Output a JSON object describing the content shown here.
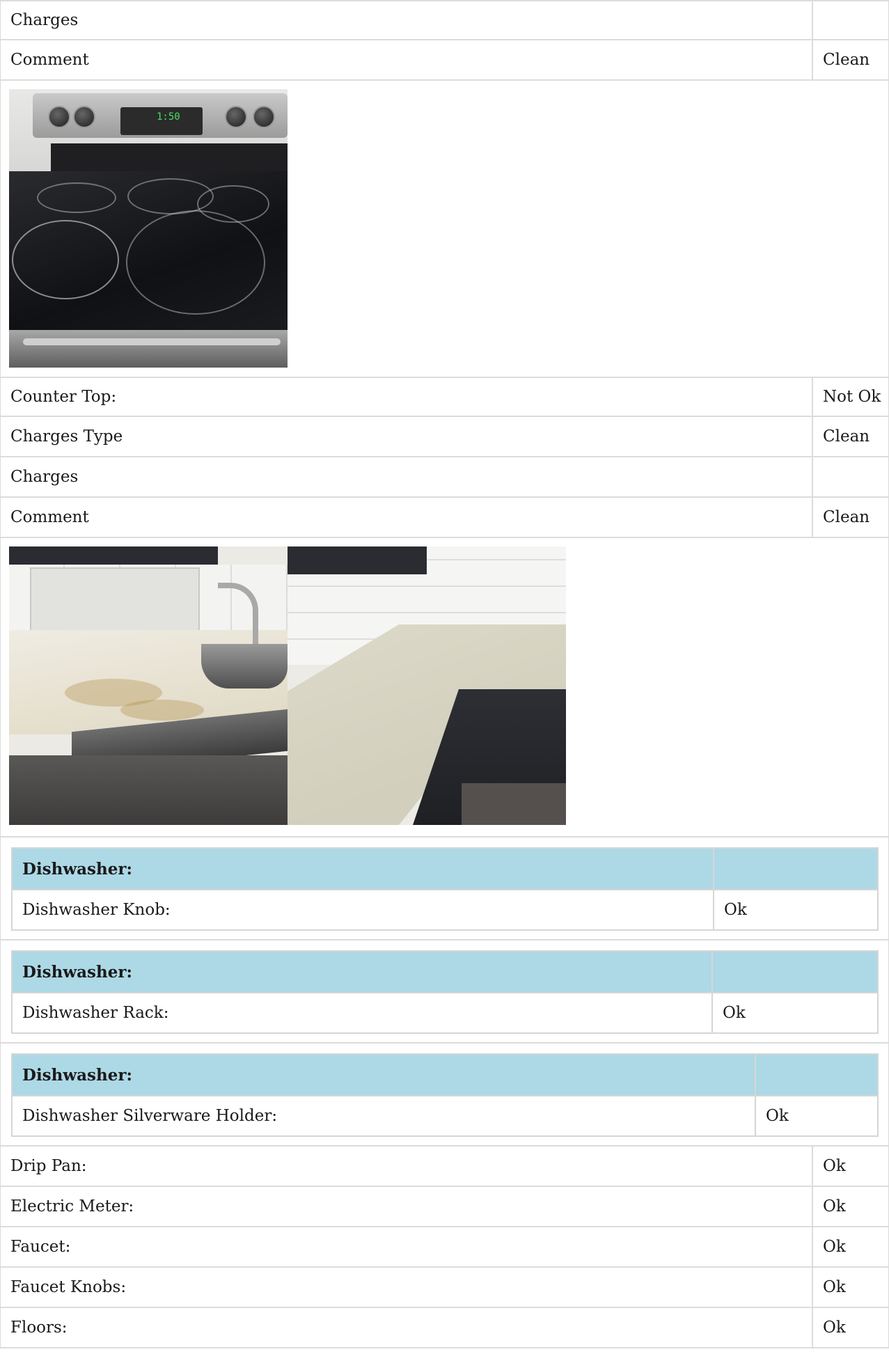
{
  "oven_section": {
    "charges_label": "Charges",
    "charges_value": "",
    "comment_label": "Comment",
    "comment_value": "Clean"
  },
  "counter_top": {
    "title_label": "Counter Top:",
    "title_value": "Not Ok",
    "charges_type_label": "Charges Type",
    "charges_type_value": "Clean",
    "charges_label": "Charges",
    "charges_value": "",
    "comment_label": "Comment",
    "comment_value": "Clean"
  },
  "dishwasher_tables": [
    {
      "header": "Dishwasher:",
      "header_value": "",
      "item_label": "Dishwasher Knob:",
      "item_value": "Ok"
    },
    {
      "header": "Dishwasher:",
      "header_value": "",
      "item_label": "Dishwasher Rack:",
      "item_value": "Ok"
    },
    {
      "header": "Dishwasher:",
      "header_value": "",
      "item_label": "Dishwasher Silverware Holder:",
      "item_value": "Ok"
    }
  ],
  "items": [
    {
      "label": "Drip Pan:",
      "value": "Ok"
    },
    {
      "label": "Electric Meter:",
      "value": "Ok"
    },
    {
      "label": "Faucet:",
      "value": "Ok"
    },
    {
      "label": "Faucet Knobs:",
      "value": "Ok"
    },
    {
      "label": "Floors:",
      "value": "Ok"
    }
  ],
  "stove_display": "1:50"
}
